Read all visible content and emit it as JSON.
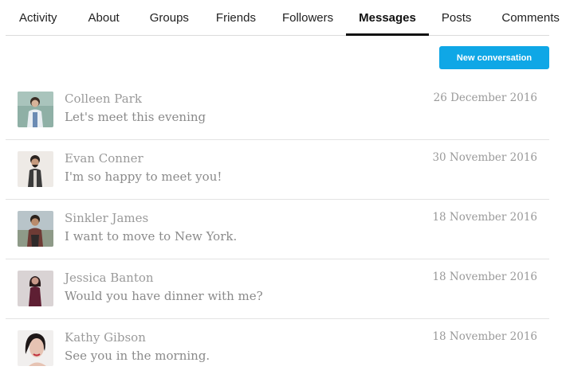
{
  "tabs": [
    {
      "label": "Activity",
      "active": false
    },
    {
      "label": "About",
      "active": false
    },
    {
      "label": "Groups",
      "active": false
    },
    {
      "label": "Friends",
      "active": false
    },
    {
      "label": "Followers",
      "active": false
    },
    {
      "label": "Messages",
      "active": true
    },
    {
      "label": "Posts",
      "active": false
    },
    {
      "label": "Comments",
      "active": false
    }
  ],
  "actions": {
    "new_conversation_label": "New conversation"
  },
  "colors": {
    "accent": "#0fa7e6",
    "active_tab": "#111111",
    "muted_text": "#9a9a9a"
  },
  "messages": [
    {
      "name": "Colleen Park",
      "preview": "Let's meet this evening",
      "date": "26 December 2016",
      "avatar": "avatar-photo"
    },
    {
      "name": "Evan Conner",
      "preview": "I'm so happy to meet you!",
      "date": "30 November 2016",
      "avatar": "avatar-photo"
    },
    {
      "name": "Sinkler James",
      "preview": "I want to move to New York.",
      "date": "18 November 2016",
      "avatar": "avatar-photo"
    },
    {
      "name": "Jessica Banton",
      "preview": "Would you have dinner with me?",
      "date": "18 November 2016",
      "avatar": "avatar-photo"
    },
    {
      "name": "Kathy Gibson",
      "preview": "See you in the morning.",
      "date": "18 November 2016",
      "avatar": "avatar-photo"
    }
  ]
}
